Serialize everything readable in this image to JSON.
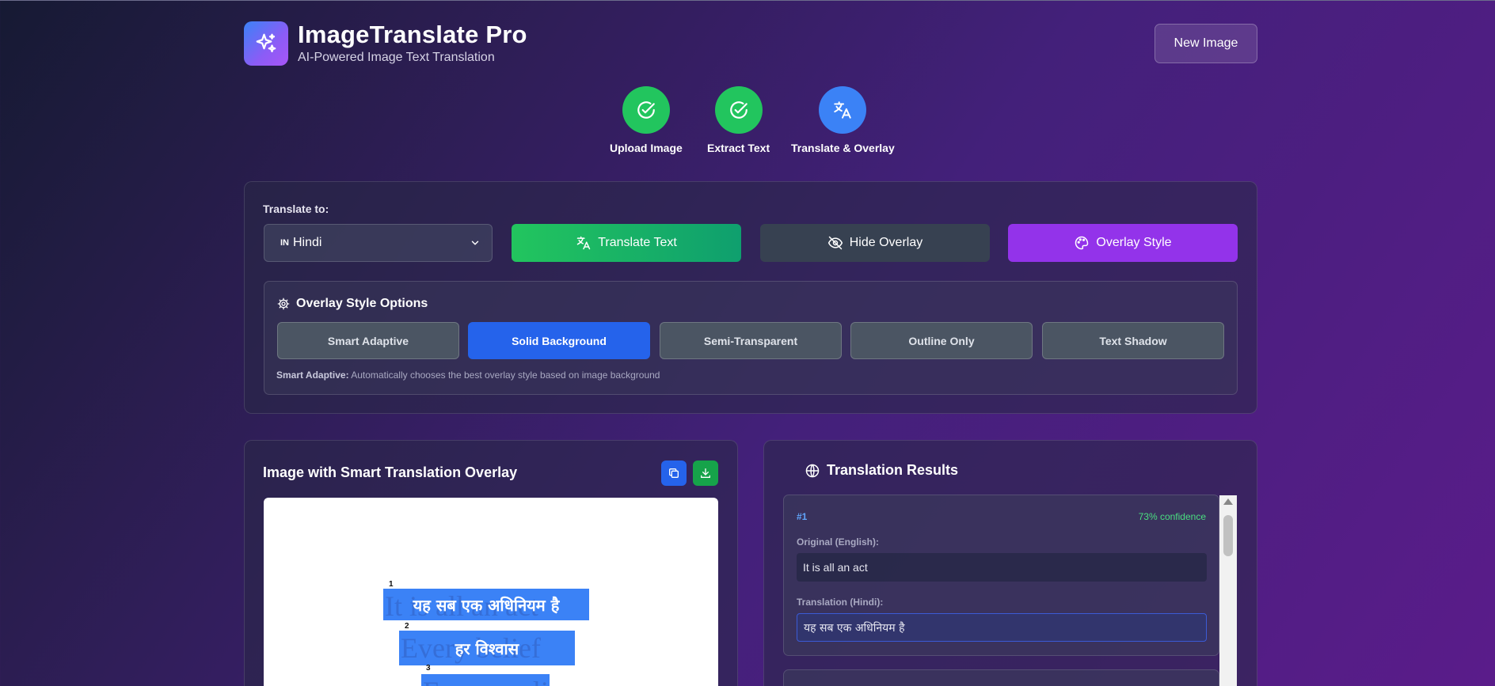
{
  "app": {
    "title": "ImageTranslate Pro",
    "subtitle": "AI-Powered Image Text Translation",
    "new_image_label": "New Image"
  },
  "steps": [
    {
      "label": "Upload Image",
      "state": "complete",
      "icon": "check-circle-icon"
    },
    {
      "label": "Extract Text",
      "state": "complete",
      "icon": "check-circle-icon"
    },
    {
      "label": "Translate & Overlay",
      "state": "active",
      "icon": "translate-icon"
    }
  ],
  "controls": {
    "translate_to_label": "Translate to:",
    "language_code": "IN",
    "language": "Hindi",
    "translate_button": "Translate Text",
    "hide_overlay_button": "Hide Overlay",
    "overlay_style_button": "Overlay Style"
  },
  "overlay_options": {
    "title": "Overlay Style Options",
    "options": [
      "Smart Adaptive",
      "Solid Background",
      "Semi-Transparent",
      "Outline Only",
      "Text Shadow"
    ],
    "selected": "Solid Background",
    "note_label": "Smart Adaptive:",
    "note_text": " Automatically chooses the best overlay style based on image background"
  },
  "image_panel": {
    "title": "Image with Smart Translation Overlay",
    "overlays": [
      {
        "num": "1",
        "original": "It is all an act",
        "translation": "यह सब एक अधिनियम है"
      },
      {
        "num": "2",
        "original": "Every belief",
        "translation": "हर विश्वास"
      },
      {
        "num": "3",
        "original": "Every reality",
        "translation": ""
      }
    ]
  },
  "results": {
    "title": "Translation Results",
    "items": [
      {
        "num": "#1",
        "confidence": "73% confidence",
        "original_label": "Original (English):",
        "original": "It is all an act",
        "translation_label": "Translation (Hindi):",
        "translation": "यह सब एक अधिनियम है"
      }
    ]
  },
  "colors": {
    "step_complete": "#22c55e",
    "step_active": "#3b82f6",
    "translate_button": "#22c55e",
    "overlay_style_button": "#9333ea",
    "selected_option": "#2563eb"
  }
}
